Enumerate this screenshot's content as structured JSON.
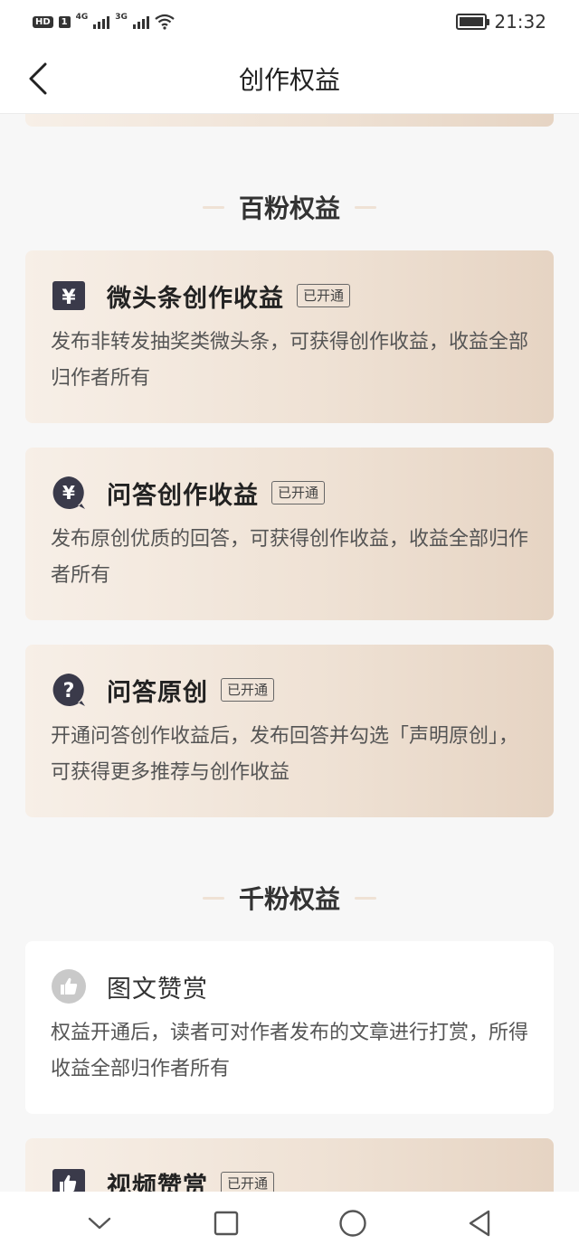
{
  "status_bar": {
    "hd": "HD",
    "sim": "1",
    "net1": "4G",
    "net2": "3G",
    "time": "21:32"
  },
  "header": {
    "title": "创作权益",
    "back_icon": "chevron-left-icon"
  },
  "sections": [
    {
      "title": "百粉权益",
      "cards": [
        {
          "icon": "yen-square-icon",
          "title": "微头条创作收益",
          "badge": "已开通",
          "desc": "发布非转发抽奖类微头条，可获得创作收益，收益全部归作者所有"
        },
        {
          "icon": "yen-bubble-icon",
          "title": "问答创作收益",
          "badge": "已开通",
          "desc": "发布原创优质的回答，可获得创作收益，收益全部归作者所有"
        },
        {
          "icon": "question-bubble-icon",
          "title": "问答原创",
          "badge": "已开通",
          "desc": "开通问答创作收益后，发布回答并勾选「声明原创」，可获得更多推荐与创作收益"
        }
      ]
    },
    {
      "title": "千粉权益",
      "cards": [
        {
          "icon": "thumbs-up-circle-icon",
          "title": "图文赞赏",
          "badge": "",
          "desc": "权益开通后，读者可对作者发布的文章进行打赏，所得收益全部归作者所有"
        },
        {
          "icon": "thumbs-up-square-icon",
          "title": "视频赞赏",
          "badge": "已开通",
          "desc": ""
        }
      ]
    }
  ],
  "nav_bar": {
    "icons": [
      "chevron-down-icon",
      "square-icon",
      "circle-icon",
      "triangle-back-icon"
    ]
  },
  "colors": {
    "card_gradient_start": "#f7efe7",
    "card_gradient_end": "#e6d4c3",
    "page_bg": "#f7f7f7",
    "icon_dark": "#3a3a4a"
  }
}
